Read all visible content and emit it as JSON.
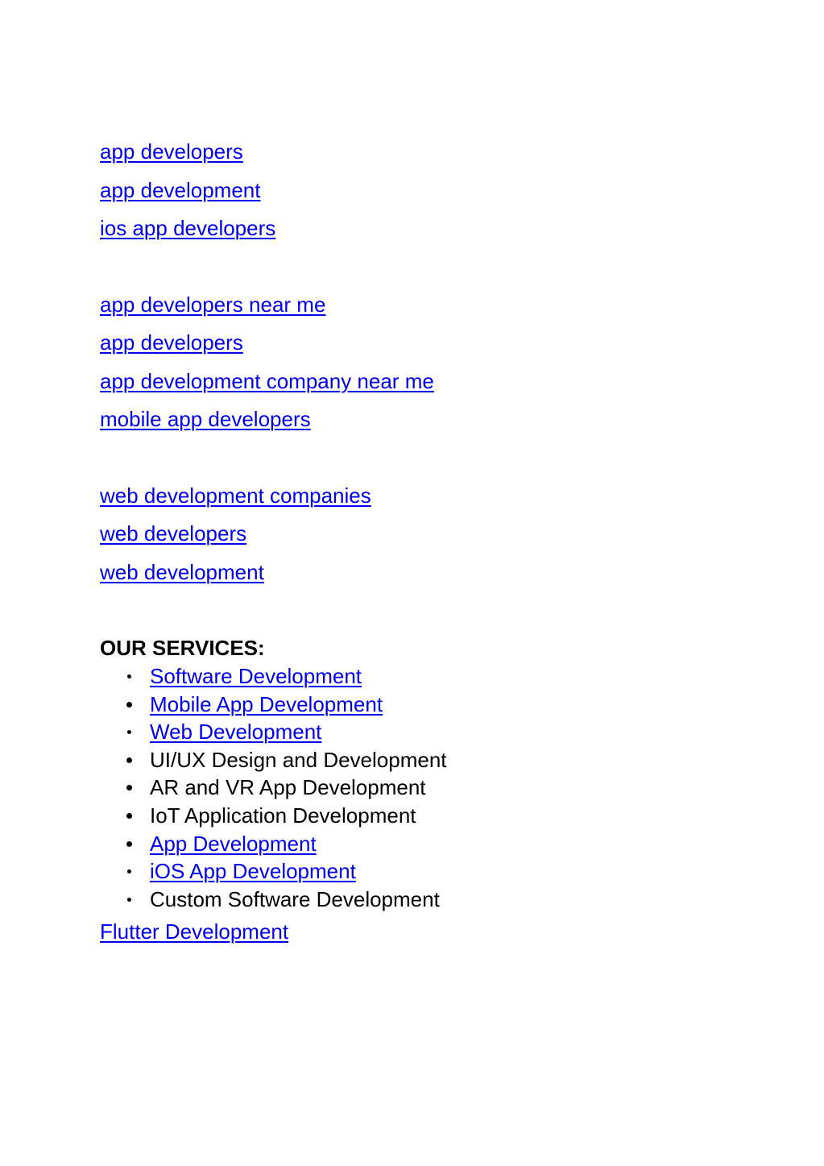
{
  "group1": {
    "links": [
      "app developers",
      "app development",
      "ios app developers"
    ]
  },
  "group2": {
    "links": [
      "app developers near me",
      "app developers",
      "app development company near me",
      "mobile app developers"
    ]
  },
  "group3": {
    "links": [
      "web development companies",
      "web developers",
      "web development"
    ]
  },
  "services": {
    "heading": "OUR SERVICES:",
    "items": [
      {
        "label": "Software Development",
        "link": true
      },
      {
        "label": "Mobile App Development",
        "link": true
      },
      {
        "label": "Web Development",
        "link": true
      },
      {
        "label": "UI/UX Design and Development",
        "link": false
      },
      {
        "label": "AR and VR App Development",
        "link": false
      },
      {
        "label": "IoT Application Development",
        "link": false
      },
      {
        "label": "App Development",
        "link": true
      },
      {
        "label": "iOS App Development",
        "link": true
      },
      {
        "label": "Custom Software Development",
        "link": false
      }
    ]
  },
  "footer": {
    "link": "Flutter Development"
  },
  "colors": {
    "link": "#0000ee",
    "text": "#000000",
    "background": "#ffffff"
  }
}
